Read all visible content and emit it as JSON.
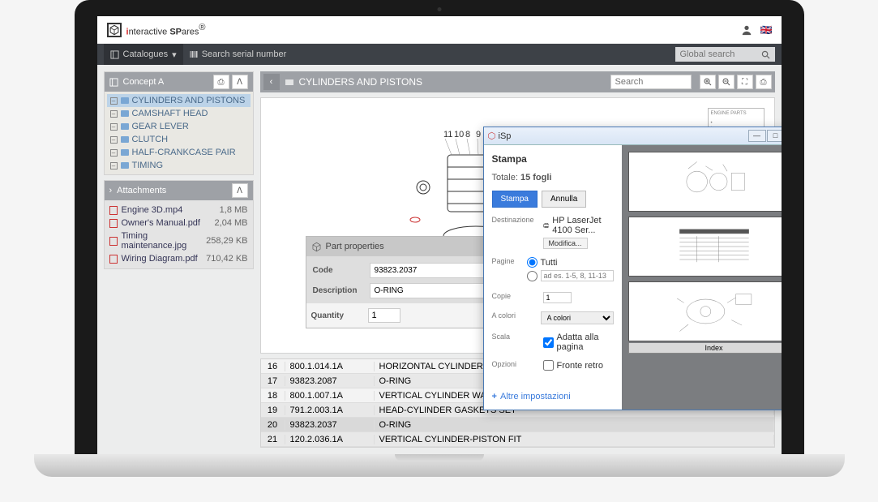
{
  "brand": {
    "i": "i",
    "nteractive": "nteractive ",
    "sp": "SP",
    "ares": "ares",
    "reg": "®"
  },
  "nav": {
    "catalogues": "Catalogues",
    "serial": "Search serial number",
    "global_ph": "Global search"
  },
  "sidebar": {
    "title": "Concept A",
    "items": [
      "CYLINDERS AND PISTONS",
      "CAMSHAFT HEAD",
      "GEAR LEVER",
      "CLUTCH",
      "HALF-CRANKCASE PAIR",
      "TIMING"
    ]
  },
  "attachments": {
    "title": "Attachments",
    "rows": [
      {
        "name": "Engine 3D.mp4",
        "size": "1,8 MB"
      },
      {
        "name": "Owner's Manual.pdf",
        "size": "2,04 MB"
      },
      {
        "name": "Timing maintenance.jpg",
        "size": "258,29 KB"
      },
      {
        "name": "Wiring Diagram.pdf",
        "size": "710,42 KB"
      }
    ]
  },
  "main": {
    "title": "CYLINDERS AND PISTONS",
    "search_ph": "Search"
  },
  "table": {
    "rows": [
      {
        "n": "16",
        "code": "800.1.014.1A",
        "desc": "HORIZONTAL CYLINDER WATER INLET"
      },
      {
        "n": "17",
        "code": "93823.2087",
        "desc": "O-RING"
      },
      {
        "n": "18",
        "code": "800.1.007.1A",
        "desc": "VERTICAL CYLINDER WATER INLET HO"
      },
      {
        "n": "19",
        "code": "791.2.003.1A",
        "desc": "HEAD-CYLINDER GASKETS SET"
      },
      {
        "n": "20",
        "code": "93823.2037",
        "desc": "O-RING",
        "hl": true
      },
      {
        "n": "21",
        "code": "120.2.036.1A",
        "desc": "VERTICAL CYLINDER-PISTON FIT"
      }
    ]
  },
  "popup": {
    "title": "Part properties",
    "code_lbl": "Code",
    "code": "93823.2037",
    "desc_lbl": "Description",
    "desc": "O-RING",
    "qty_lbl": "Quantity",
    "qty": "1"
  },
  "print": {
    "win": "iSp",
    "title": "Stampa",
    "total_lbl": "Totale: ",
    "total_val": "15 fogli",
    "btn_print": "Stampa",
    "btn_cancel": "Annulla",
    "dest_lbl": "Destinazione",
    "dest_val": "HP LaserJet 4100 Ser...",
    "mod": "Modifica...",
    "pages_lbl": "Pagine",
    "pages_all": "Tutti",
    "pages_ph": "ad es. 1-5, 8, 11-13",
    "copies_lbl": "Copie",
    "copies": "1",
    "color_lbl": "A colori",
    "color_val": "A colori",
    "scale_lbl": "Scala",
    "scale_chk": "Adatta alla pagina",
    "opts_lbl": "Opzioni",
    "opts_chk": "Fronte retro",
    "more": "Altre impostazioni",
    "index": "Index"
  }
}
